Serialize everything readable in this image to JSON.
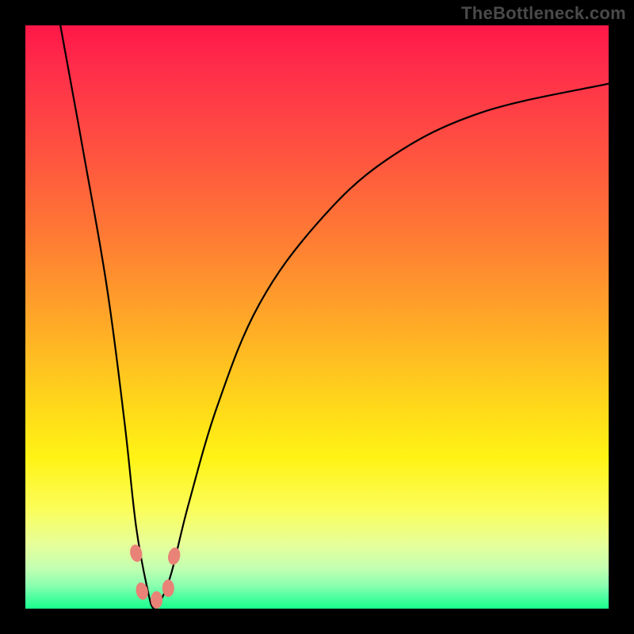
{
  "watermark": "TheBottleneck.com",
  "colors": {
    "frame": "#000000",
    "gradient_top": "#ff1748",
    "gradient_mid": "#ffd11c",
    "gradient_bottom": "#1aff8e",
    "curve": "#000000",
    "marker": "#e98277"
  },
  "chart_data": {
    "type": "line",
    "title": "",
    "xlabel": "",
    "ylabel": "",
    "x_range": [
      0,
      100
    ],
    "y_range": [
      0,
      100
    ],
    "notes": "V-shaped bottleneck curve on a red-to-green vertical gradient; minimum (optimal) near x≈22. y shown as percent bottleneck, 0 at bottom (green) to 100 at top (red).",
    "series": [
      {
        "name": "bottleneck-curve",
        "x": [
          6,
          10,
          14,
          17,
          19,
          21,
          22,
          23,
          25,
          28,
          33,
          40,
          50,
          62,
          78,
          100
        ],
        "y": [
          100,
          78,
          55,
          32,
          14,
          3,
          0,
          1,
          6,
          18,
          35,
          52,
          66,
          77,
          85,
          90
        ]
      }
    ],
    "markers": {
      "name": "highlight-dots",
      "note": "Salmon lozenge markers clustered around the curve minimum",
      "points": [
        {
          "x": 19.0,
          "y": 9.5
        },
        {
          "x": 20.0,
          "y": 3.0
        },
        {
          "x": 22.5,
          "y": 1.5
        },
        {
          "x": 24.5,
          "y": 3.5
        },
        {
          "x": 25.5,
          "y": 9.0
        }
      ]
    }
  }
}
